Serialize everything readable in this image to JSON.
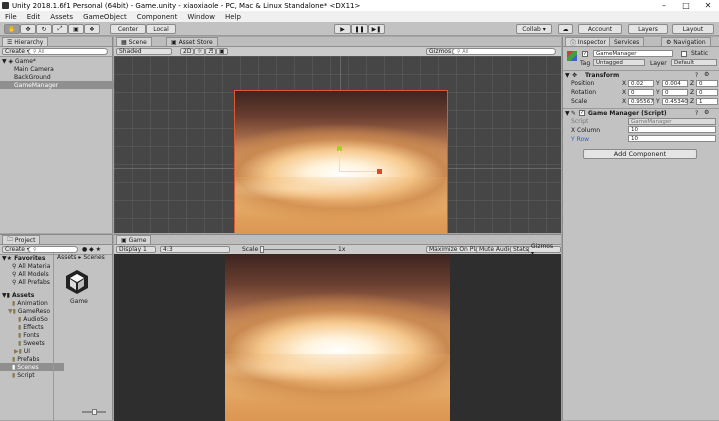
{
  "window": {
    "title": "Unity 2018.1.6f1 Personal (64bit) - Game.unity - xiaoxiaole - PC, Mac & Linux Standalone* <DX11>"
  },
  "menu": [
    "File",
    "Edit",
    "Assets",
    "GameObject",
    "Component",
    "Window",
    "Help"
  ],
  "toolbar": {
    "center": "Center",
    "local": "Local",
    "collab": "Collab ▾",
    "account": "Account",
    "layers": "Layers",
    "layout": "Layout"
  },
  "hierarchy": {
    "tab": "Hierarchy",
    "create": "Create ▾",
    "search": "All",
    "scene": "Game*",
    "items": [
      "Main Camera",
      "BackGround",
      "GameManager"
    ]
  },
  "scene": {
    "tab": "Scene",
    "asset_store": "Asset Store",
    "shaded": "Shaded",
    "mode_2d": "2D",
    "gizmos": "Gizmos ▾",
    "search": "All"
  },
  "game": {
    "tab": "Game",
    "display": "Display 1",
    "aspect": "4:3",
    "scale_label": "Scale",
    "scale_value": "1x",
    "maximize": "Maximize On Play",
    "mute": "Mute Audio",
    "stats": "Stats",
    "gizmos": "Gizmos ▾"
  },
  "project": {
    "tab": "Project",
    "create": "Create ▾",
    "favorites": "Favorites",
    "fav_items": [
      "All Materia",
      "All Models",
      "All Prefabs"
    ],
    "assets": "Assets",
    "tree": [
      "Animation",
      "GameReso",
      "AudioSo",
      "Effects",
      "Fonts",
      "Sweets",
      "UI",
      "Prefabs",
      "Scenes",
      "Script"
    ],
    "breadcrumb": "Assets ▸ Scenes",
    "file_name": "Game"
  },
  "inspector": {
    "tab": "Inspector",
    "services": "Services",
    "navigation": "Navigation",
    "object_name": "GameManager",
    "static": "Static",
    "tag_label": "Tag",
    "tag": "Untagged",
    "layer_label": "Layer",
    "layer": "Default",
    "transform": "Transform",
    "position_label": "Position",
    "rotation_label": "Rotation",
    "scale_label": "Scale",
    "position": {
      "x": "0.02",
      "y": "0.004",
      "z": "0"
    },
    "rotation": {
      "x": "0",
      "y": "0",
      "z": "0"
    },
    "scale": {
      "x": "0.95567",
      "y": "0.45340",
      "z": "1"
    },
    "script_header": "Game Manager (Script)",
    "script_label": "Script",
    "script_value": "GameManager",
    "x_column_label": "X Column",
    "x_column": "10",
    "y_row_label": "Y Row",
    "y_row": "10",
    "add_component": "Add Component"
  }
}
